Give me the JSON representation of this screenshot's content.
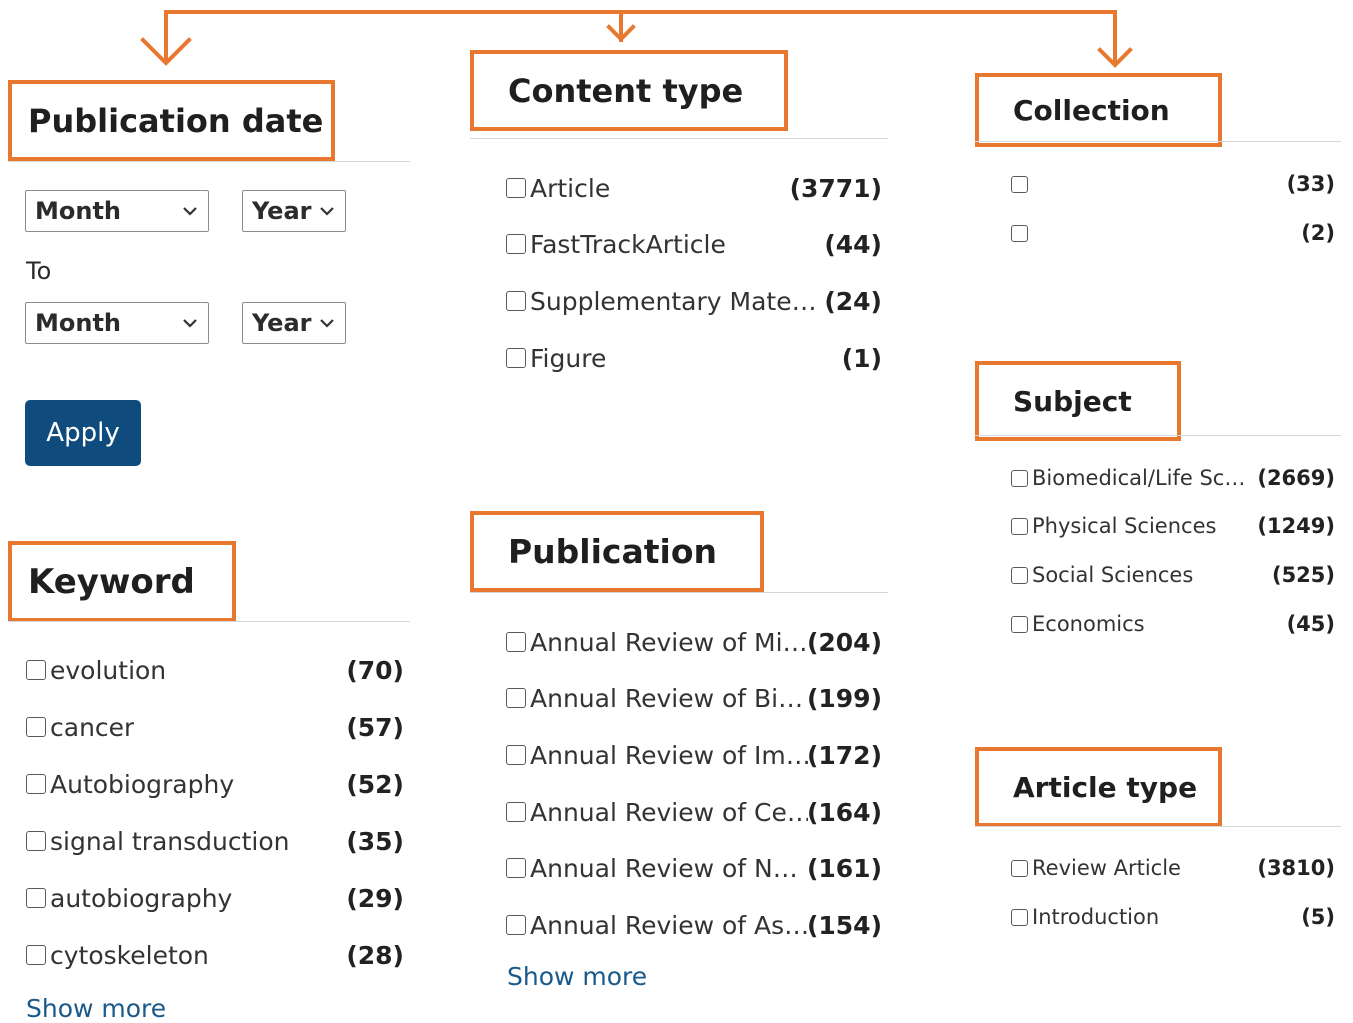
{
  "accent_color": "#e8782f",
  "apply_color": "#0f4b7c",
  "link_color": "#1a5a8a",
  "publication_date": {
    "title": "Publication date",
    "from_month": "Month",
    "from_year": "Year",
    "to_label": "To",
    "to_month": "Month",
    "to_year": "Year",
    "apply_label": "Apply"
  },
  "content_type": {
    "title": "Content type",
    "items": [
      {
        "label": "Article",
        "count": "(3771)"
      },
      {
        "label": "FastTrackArticle",
        "count": "(44)"
      },
      {
        "label": "Supplementary Mate…",
        "count": "(24)"
      },
      {
        "label": "Figure",
        "count": "(1)"
      }
    ]
  },
  "collection": {
    "title": "Collection",
    "items": [
      {
        "label": "",
        "count": "(33)"
      },
      {
        "label": "",
        "count": "(2)"
      }
    ]
  },
  "keyword": {
    "title": "Keyword",
    "items": [
      {
        "label": "evolution",
        "count": "(70)"
      },
      {
        "label": "cancer",
        "count": "(57)"
      },
      {
        "label": "Autobiography",
        "count": "(52)"
      },
      {
        "label": "signal transduction",
        "count": "(35)"
      },
      {
        "label": "autobiography",
        "count": "(29)"
      },
      {
        "label": "cytoskeleton",
        "count": "(28)"
      }
    ],
    "show_more": "Show more"
  },
  "publication": {
    "title": "Publication",
    "items": [
      {
        "label": "Annual Review of Mi…",
        "count": "(204)"
      },
      {
        "label": "Annual Review of Bi…",
        "count": "(199)"
      },
      {
        "label": "Annual Review of Im…",
        "count": "(172)"
      },
      {
        "label": "Annual Review of Ce…",
        "count": "(164)"
      },
      {
        "label": "Annual Review of N…",
        "count": "(161)"
      },
      {
        "label": "Annual Review of As…",
        "count": "(154)"
      }
    ],
    "show_more": "Show more"
  },
  "subject": {
    "title": "Subject",
    "items": [
      {
        "label": "Biomedical/Life Sc…",
        "count": "(2669)"
      },
      {
        "label": "Physical Sciences",
        "count": "(1249)"
      },
      {
        "label": "Social Sciences",
        "count": "(525)"
      },
      {
        "label": "Economics",
        "count": "(45)"
      }
    ]
  },
  "article_type": {
    "title": "Article type",
    "items": [
      {
        "label": "Review Article",
        "count": "(3810)"
      },
      {
        "label": "Introduction",
        "count": "(5)"
      }
    ]
  }
}
